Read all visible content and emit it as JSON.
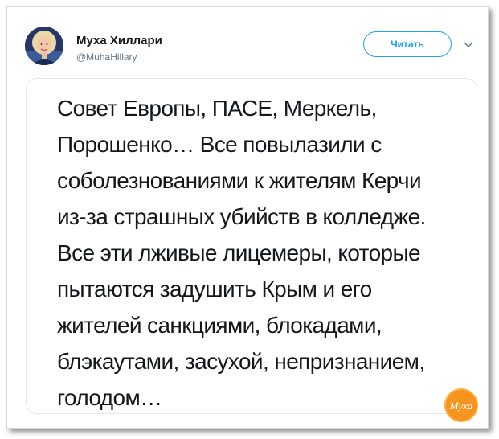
{
  "author": {
    "name": "Муха Хиллари",
    "handle": "@MuhaHillary"
  },
  "follow_label": "Читать",
  "tweet": {
    "lines": [
      "Совет Европы, ПАСЕ, Меркель,",
      "Порошенко… Все повылазили с",
      "соболезнованиями к жителям Керчи",
      "из-за страшных убийств в колледже.",
      "Все эти лживые лицемеры, которые",
      "пытаются задушить Крым и его",
      "жителей санкциями, блокадами,",
      "блэкаутами, засухой, непризнанием,",
      "голодом…"
    ]
  },
  "watermark": {
    "text": "Муха"
  },
  "colors": {
    "accent": "#1da1f2",
    "logo": "#f7941d"
  },
  "icons": {
    "caret": "chevron-down-icon",
    "logo": "muha-logo-icon"
  }
}
